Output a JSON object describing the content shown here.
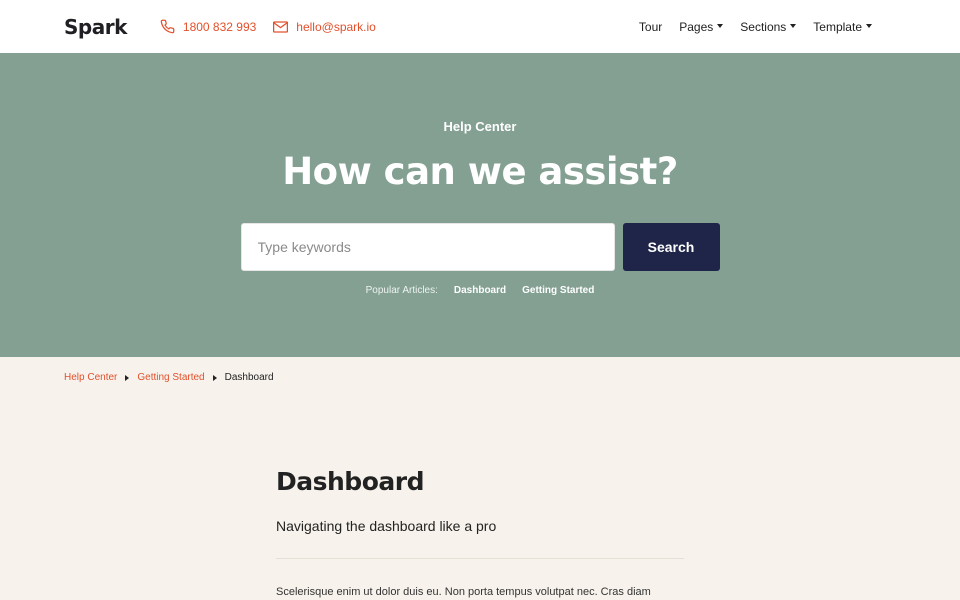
{
  "header": {
    "logo": "Spark",
    "phone": "1800 832 993",
    "email": "hello@spark.io",
    "nav": [
      {
        "label": "Tour",
        "dropdown": false
      },
      {
        "label": "Pages",
        "dropdown": true
      },
      {
        "label": "Sections",
        "dropdown": true
      },
      {
        "label": "Template",
        "dropdown": true
      }
    ]
  },
  "hero": {
    "eyebrow": "Help Center",
    "title": "How can we assist?",
    "search_placeholder": "Type keywords",
    "search_button": "Search",
    "popular_label": "Popular Articles:",
    "popular_links": [
      "Dashboard",
      "Getting Started"
    ]
  },
  "breadcrumb": {
    "items": [
      "Help Center",
      "Getting Started"
    ],
    "current": "Dashboard"
  },
  "article": {
    "title": "Dashboard",
    "subtitle": "Navigating the dashboard like a pro",
    "body": "Scelerisque enim ut dolor duis eu. Non porta tempus volutpat nec. Cras diam eleifend facilisis tellus. Adipiscing nullam amet, ut ut elementum id ac est."
  },
  "colors": {
    "accent": "#e2502c",
    "hero_bg": "#83a093",
    "button_bg": "#1e2549",
    "page_bg": "#f7f3ec"
  },
  "icons": {
    "phone": "phone-icon",
    "email": "mail-icon"
  }
}
